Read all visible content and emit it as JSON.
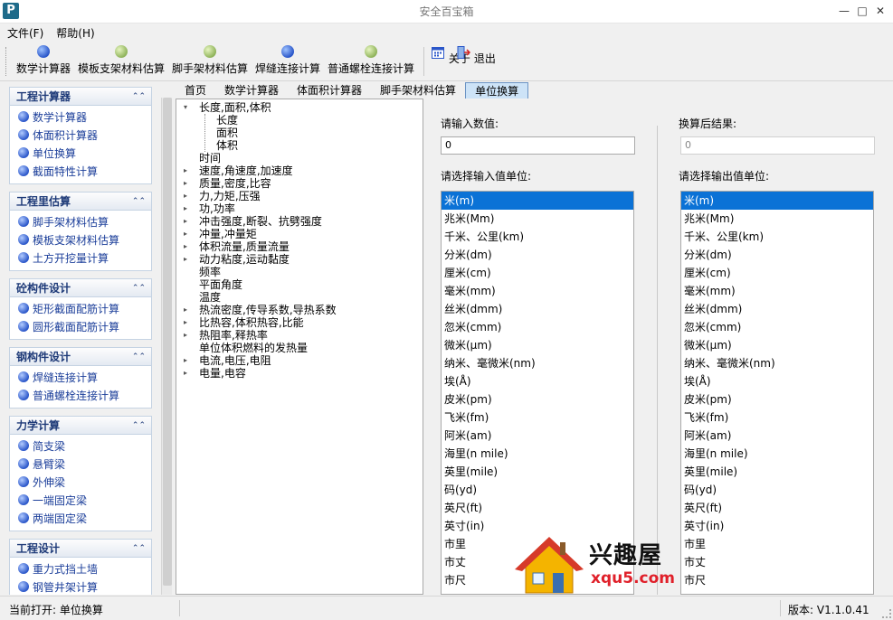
{
  "window": {
    "title": "安全百宝箱",
    "app_icon_letter": "P",
    "controls": {
      "minimize": "—",
      "maximize": "□",
      "close": "✕"
    }
  },
  "menubar": {
    "items": [
      {
        "label": "文件(F)"
      },
      {
        "label": "帮助(H)"
      }
    ]
  },
  "toolbar": {
    "buttons": [
      {
        "label": "数学计算器",
        "ball": "blue"
      },
      {
        "label": "模板支架材料估算",
        "ball": "green"
      },
      {
        "label": "脚手架材料估算",
        "ball": "green"
      },
      {
        "label": "焊缝连接计算",
        "ball": "blue"
      },
      {
        "label": "普通螺栓连接计算",
        "ball": "green"
      }
    ],
    "about_label": "关于",
    "exit_label": "退出"
  },
  "sidebar": {
    "groups": [
      {
        "title": "工程计算器",
        "items": [
          "数学计算器",
          "体面积计算器",
          "单位换算",
          "截面特性计算"
        ]
      },
      {
        "title": "工程里估算",
        "items": [
          "脚手架材料估算",
          "模板支架材料估算",
          "土方开挖量计算"
        ]
      },
      {
        "title": "砼构件设计",
        "items": [
          "矩形截面配筋计算",
          "圆形截面配筋计算"
        ]
      },
      {
        "title": "钢构件设计",
        "items": [
          "焊缝连接计算",
          "普通螺栓连接计算"
        ]
      },
      {
        "title": "力学计算",
        "items": [
          "简支梁",
          "悬臂梁",
          "外伸梁",
          "一端固定梁",
          "两端固定梁"
        ]
      },
      {
        "title": "工程设计",
        "items": [
          "重力式挡土墙",
          "钢管井架计算"
        ]
      }
    ]
  },
  "tabs": {
    "items": [
      "首页",
      "数学计算器",
      "体面积计算器",
      "脚手架材料估算",
      "单位换算"
    ],
    "active_index": 4
  },
  "tree": {
    "nodes": [
      {
        "label": "长度,面积,体积",
        "level": 0,
        "arrow": "expanded"
      },
      {
        "label": "长度",
        "level": 1,
        "arrow": "none"
      },
      {
        "label": "面积",
        "level": 1,
        "arrow": "none"
      },
      {
        "label": "体积",
        "level": 1,
        "arrow": "none"
      },
      {
        "label": "时间",
        "level": 0,
        "arrow": "none"
      },
      {
        "label": "速度,角速度,加速度",
        "level": 0,
        "arrow": "collapsed"
      },
      {
        "label": "质量,密度,比容",
        "level": 0,
        "arrow": "collapsed"
      },
      {
        "label": "力,力矩,压强",
        "level": 0,
        "arrow": "collapsed"
      },
      {
        "label": "功,功率",
        "level": 0,
        "arrow": "collapsed"
      },
      {
        "label": "冲击强度,断裂、抗劈强度",
        "level": 0,
        "arrow": "collapsed"
      },
      {
        "label": "冲量,冲量矩",
        "level": 0,
        "arrow": "collapsed"
      },
      {
        "label": "体积流量,质量流量",
        "level": 0,
        "arrow": "collapsed"
      },
      {
        "label": "动力粘度,运动黏度",
        "level": 0,
        "arrow": "collapsed"
      },
      {
        "label": "频率",
        "level": 0,
        "arrow": "none"
      },
      {
        "label": "平面角度",
        "level": 0,
        "arrow": "none"
      },
      {
        "label": "温度",
        "level": 0,
        "arrow": "none"
      },
      {
        "label": "热流密度,传导系数,导热系数",
        "level": 0,
        "arrow": "collapsed"
      },
      {
        "label": "比热容,体积热容,比能",
        "level": 0,
        "arrow": "collapsed"
      },
      {
        "label": "热阻率,释热率",
        "level": 0,
        "arrow": "collapsed"
      },
      {
        "label": "单位体积燃料的发热量",
        "level": 0,
        "arrow": "none"
      },
      {
        "label": "电流,电压,电阻",
        "level": 0,
        "arrow": "collapsed"
      },
      {
        "label": "电量,电容",
        "level": 0,
        "arrow": "collapsed"
      }
    ]
  },
  "converter": {
    "input_label": "请输入数值:",
    "input_value": "0",
    "result_label": "换算后结果:",
    "result_value": "0",
    "input_unit_label": "请选择输入值单位:",
    "output_unit_label": "请选择输出值单位:",
    "units": [
      "米(m)",
      "兆米(Mm)",
      "千米、公里(km)",
      "分米(dm)",
      "厘米(cm)",
      "毫米(mm)",
      "丝米(dmm)",
      "忽米(cmm)",
      "微米(μm)",
      "纳米、毫微米(nm)",
      "埃(Å)",
      "皮米(pm)",
      "飞米(fm)",
      "阿米(am)",
      "海里(n mile)",
      "英里(mile)",
      "码(yd)",
      "英尺(ft)",
      "英寸(in)",
      "市里",
      "市丈",
      "市尺"
    ],
    "selected_input_index": 0,
    "selected_output_index": 0
  },
  "watermark": {
    "name": "兴趣屋",
    "url": "xqu5.com"
  },
  "statusbar": {
    "current_label": "当前打开: 单位换算",
    "version": "版本: V1.1.0.41"
  },
  "colors": {
    "accent": "#0b72d6",
    "group_title": "#1e3a78",
    "link": "#1c3f9a"
  }
}
